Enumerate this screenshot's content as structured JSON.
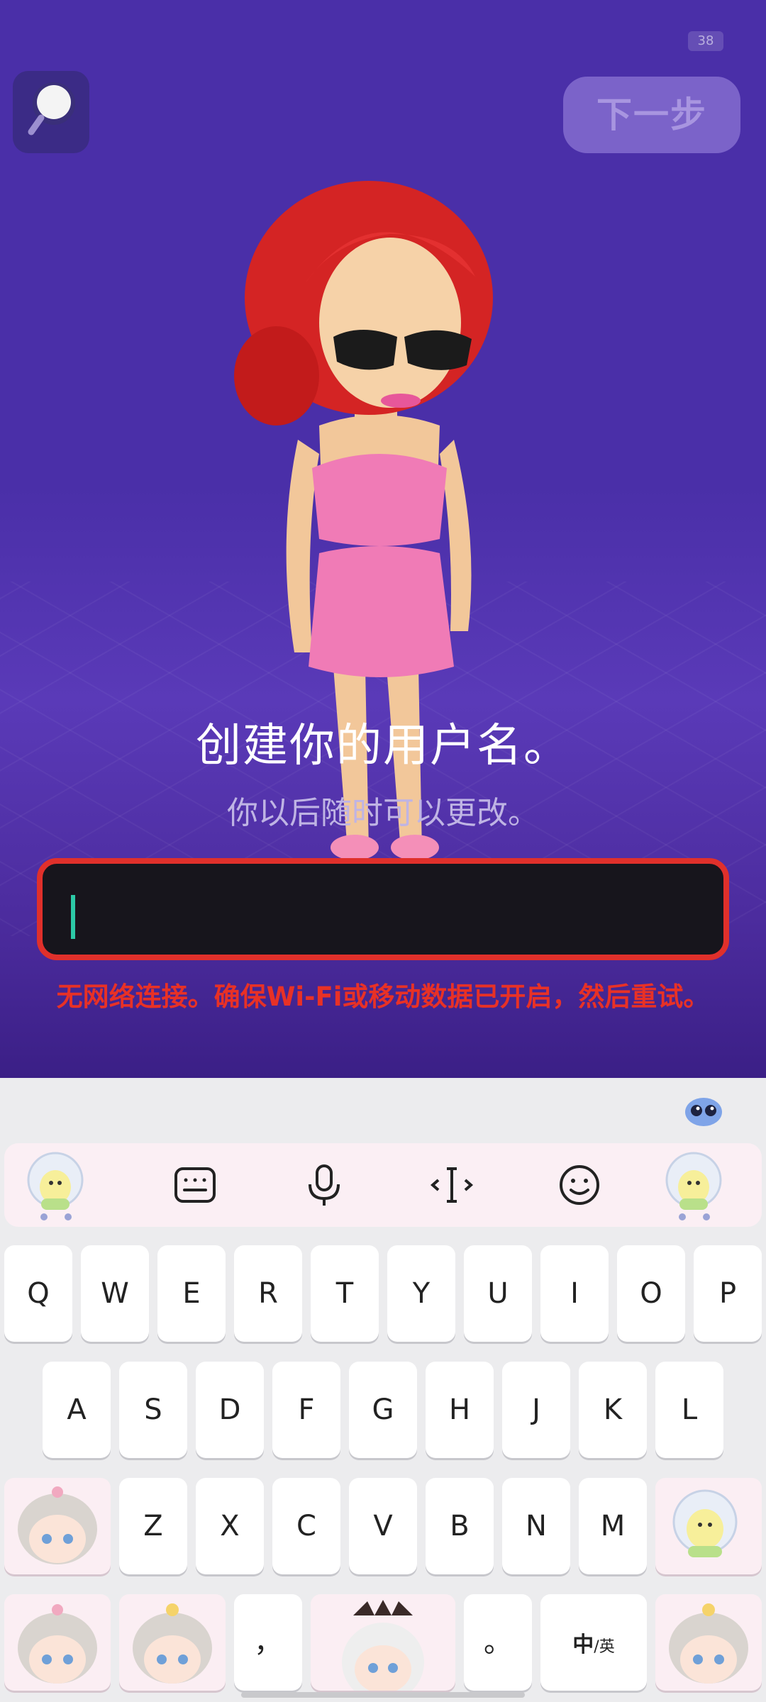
{
  "status": {
    "battery": "38"
  },
  "header": {
    "next_label": "下一步"
  },
  "main": {
    "title": "创建你的用户名。",
    "subtitle": "你以后随时可以更改。",
    "input_value": "",
    "error": "无网络连接。确保Wi-Fi或移动数据已开启，然后重试。"
  },
  "keyboard": {
    "toolbar": [
      "keyboard-icon",
      "microphone-icon",
      "cursor-icon",
      "emoji-icon"
    ],
    "row1": [
      "Q",
      "W",
      "E",
      "R",
      "T",
      "Y",
      "U",
      "I",
      "O",
      "P"
    ],
    "row2": [
      "A",
      "S",
      "D",
      "F",
      "G",
      "H",
      "J",
      "K",
      "L"
    ],
    "row3": [
      "Z",
      "X",
      "C",
      "V",
      "B",
      "N",
      "M"
    ],
    "comma": "，",
    "period": "。",
    "lang_main": "中",
    "lang_alt": "/英"
  },
  "colors": {
    "accent": "#4a2fa8",
    "error": "#e83126",
    "caret": "#2cc9a6"
  }
}
